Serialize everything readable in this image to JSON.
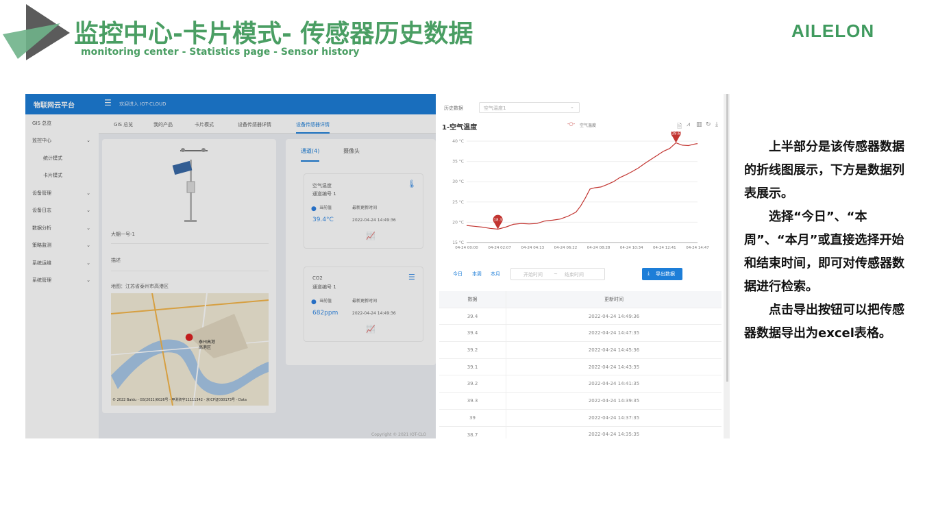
{
  "slide": {
    "title": "监控中心-卡片模式- 传感器历史数据",
    "subtitle": "monitoring center - Statistics page - Sensor history",
    "brand": "AILELON",
    "description": [
      "上半部分是该传感器数据的折线图展示，下方是数据列表展示。",
      "选择“今日”、“本周”、“本月”或直接选择开始和结束时间，即可对传感器数据进行检索。",
      "点击导出按钮可以把传感器数据导出为excel表格。"
    ]
  },
  "app": {
    "logo": "物联网云平台",
    "welcome": "欢迎进入 IOT-CLOUD",
    "sidebar": [
      {
        "label": "GIS 总览"
      },
      {
        "label": "监控中心"
      },
      {
        "label": "统计模式"
      },
      {
        "label": "卡片模式"
      },
      {
        "label": "设备管理"
      },
      {
        "label": "设备日志"
      },
      {
        "label": "数据分析"
      },
      {
        "label": "策略监测"
      },
      {
        "label": "系统运维"
      },
      {
        "label": "系统管理"
      }
    ],
    "tabs": [
      "GIS 总览",
      "我的产品",
      "卡片模式",
      "设备传感器详情",
      "设备传感器详情"
    ],
    "device": {
      "name": "大棚一号-1",
      "desc_label": "描述",
      "address": "地图：江苏省泰州市高港区",
      "map_label_1": "泰州高港",
      "map_label_2": "高港区",
      "map_copyright": "© 2022 Baidu - GS(2021)6026号 - 甲测资字11111342 - 京ICP证030173号 - Data"
    },
    "sensor_tabs": [
      "通道(4)",
      "摄像头"
    ],
    "sensors": [
      {
        "name": "空气温度",
        "channel": "通道编号 1",
        "cur_label": "当前值",
        "time_label": "最新更新时间",
        "value": "39.4°C",
        "time": "2022-04-24 14:49:36"
      },
      {
        "name": "CO2",
        "channel": "通道编号 1",
        "cur_label": "当前值",
        "time_label": "最新更新时间",
        "value": "682ppm",
        "time": "2022-04-24 14:49:36"
      }
    ],
    "copyright": "Copyright © 2021 IOT-CLO"
  },
  "history": {
    "select_label": "历史数据",
    "select_value": "空气温度1",
    "chart_title": "1-空气温度",
    "quick": [
      "今日",
      "本周",
      "本月"
    ],
    "start_placeholder": "开始时间",
    "end_placeholder": "结束时间",
    "range_sep": "~",
    "export_label": "导出数据",
    "table_headers": [
      "数据",
      "更新时间"
    ],
    "rows": [
      [
        "39.4",
        "2022-04-24 14:49:36"
      ],
      [
        "39.4",
        "2022-04-24 14:47:35"
      ],
      [
        "39.2",
        "2022-04-24 14:45:36"
      ],
      [
        "39.1",
        "2022-04-24 14:43:35"
      ],
      [
        "39.2",
        "2022-04-24 14:41:35"
      ],
      [
        "39.3",
        "2022-04-24 14:39:35"
      ],
      [
        "39",
        "2022-04-24 14:37:35"
      ],
      [
        "38.7",
        "2022-04-24 14:35:35"
      ]
    ]
  },
  "chart_data": {
    "type": "line",
    "legend": [
      "空气温度"
    ],
    "x_ticks": [
      "04-24 00:00",
      "04-24 02:07",
      "04-24 04:13",
      "04-24 06:22",
      "04-24 08:28",
      "04-24 10:34",
      "04-24 12:41",
      "04-24 14:47"
    ],
    "y_ticks": [
      "15 °C",
      "20 °C",
      "25 °C",
      "30 °C",
      "35 °C",
      "40 °C"
    ],
    "ylim": [
      15,
      40
    ],
    "xlim_hours": [
      0,
      14.78
    ],
    "series": [
      {
        "name": "空气温度",
        "color": "#c23531",
        "points": [
          [
            0,
            19.2
          ],
          [
            0.5,
            19.0
          ],
          [
            1,
            18.8
          ],
          [
            1.5,
            18.5
          ],
          [
            2,
            18.3
          ],
          [
            2.5,
            18.8
          ],
          [
            3,
            19.5
          ],
          [
            3.5,
            19.7
          ],
          [
            4,
            19.6
          ],
          [
            4.5,
            19.7
          ],
          [
            5,
            20.3
          ],
          [
            5.5,
            20.5
          ],
          [
            6,
            20.8
          ],
          [
            6.5,
            21.5
          ],
          [
            7,
            22.5
          ],
          [
            7.3,
            24
          ],
          [
            7.6,
            26
          ],
          [
            7.9,
            28.2
          ],
          [
            8.2,
            28.5
          ],
          [
            8.6,
            28.7
          ],
          [
            9,
            29.3
          ],
          [
            9.4,
            30.0
          ],
          [
            9.8,
            31.0
          ],
          [
            10.2,
            31.7
          ],
          [
            10.6,
            32.5
          ],
          [
            11,
            33.4
          ],
          [
            11.4,
            34.5
          ],
          [
            11.8,
            35.5
          ],
          [
            12.2,
            36.5
          ],
          [
            12.6,
            37.5
          ],
          [
            13,
            38.2
          ],
          [
            13.4,
            39.6
          ],
          [
            13.8,
            39.0
          ],
          [
            14.2,
            38.9
          ],
          [
            14.5,
            39.2
          ],
          [
            14.78,
            39.4
          ]
        ]
      }
    ],
    "mark_max": 39.6,
    "mark_min": 18.3
  }
}
